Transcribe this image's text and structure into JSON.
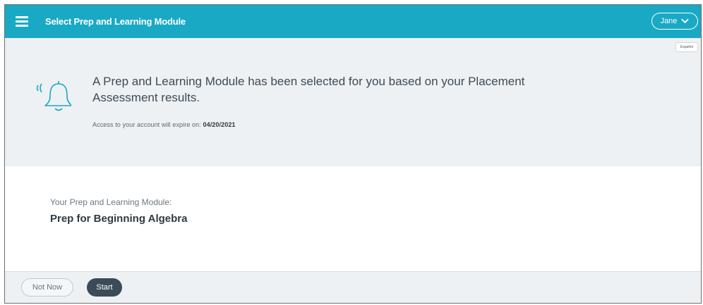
{
  "header": {
    "title": "Select Prep and Learning Module",
    "user_name": "Jane",
    "menu_icon": "hamburger-menu-icon",
    "user_chevron_icon": "chevron-down-icon",
    "accent_color": "#19a9c4"
  },
  "banner": {
    "language_label": "Español",
    "icon": "bell-icon",
    "message": "A Prep and Learning Module has been selected for you based on your Placement Assessment results.",
    "expire_label": "Access to your account will expire on:",
    "expire_date": "04/20/2021"
  },
  "module": {
    "label": "Your Prep and Learning Module:",
    "name": "Prep for Beginning Algebra"
  },
  "footer": {
    "not_now_label": "Not Now",
    "start_label": "Start",
    "start_color": "#3b4b58"
  }
}
